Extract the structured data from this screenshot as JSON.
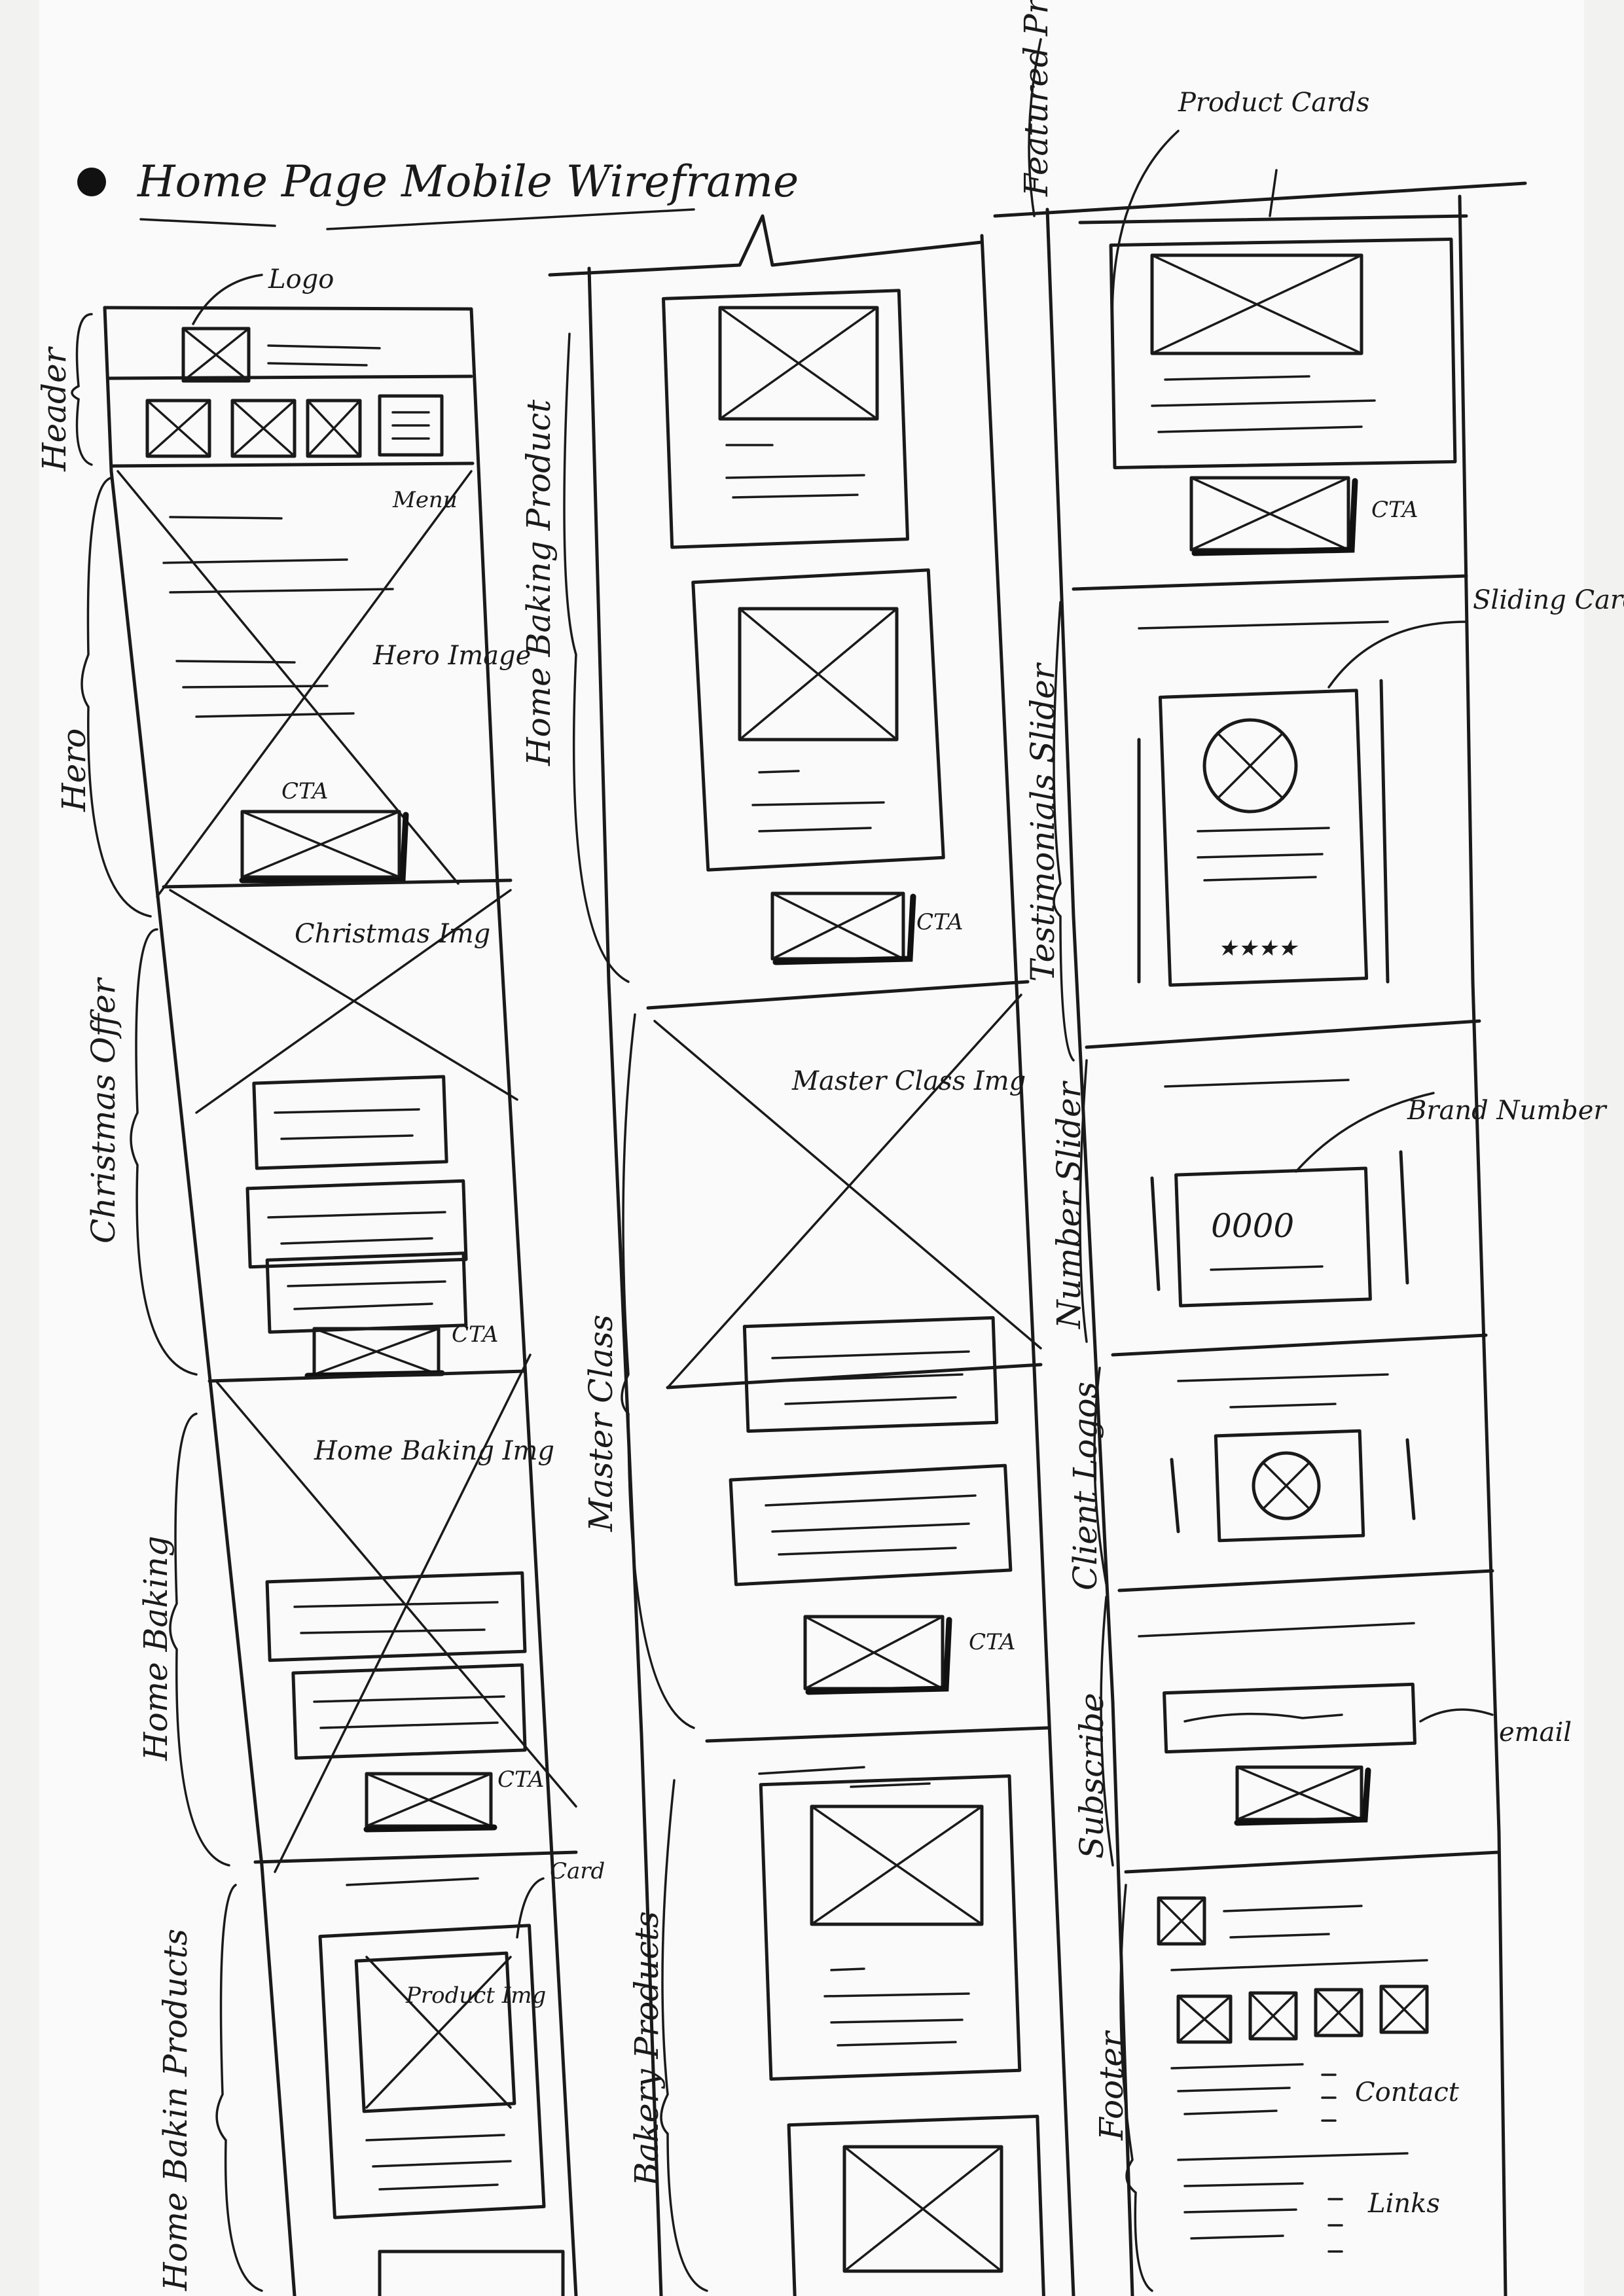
{
  "title": "Home Page Mobile Wireframe",
  "section_labels": {
    "header": "Header",
    "hero": "Hero",
    "christmas_offer": "Christmas Offer",
    "home_baking": "Home Baking",
    "home_baking_products_bottom": "Home Bakin Products",
    "home_baking_product_side": "Home Baking Product",
    "master_class": "Master Class",
    "bakery_products": "Bakery Products",
    "featured_products": "Featured Products",
    "testimonials_slider": "Testimonials Slider",
    "number_slider": "Number Slider",
    "client_logos": "Client Logos",
    "subscribe": "Subscribe",
    "footer": "Footer"
  },
  "annotations": {
    "logo": "Logo",
    "menu": "Menu",
    "hero_image": "Hero Image",
    "cta": "CTA",
    "christmas_img": "Christmas Img",
    "home_baking_img": "Home Baking Img",
    "card": "Card",
    "product_img": "Product Img",
    "master_class_img": "Master Class Img",
    "product_cards": "Product Cards",
    "sliding_cards": "Sliding Cards",
    "brand_number": "Brand Number",
    "number_digits": "0000",
    "stars": "★★★★",
    "email": "email",
    "contact": "Contact",
    "links": "Links"
  }
}
